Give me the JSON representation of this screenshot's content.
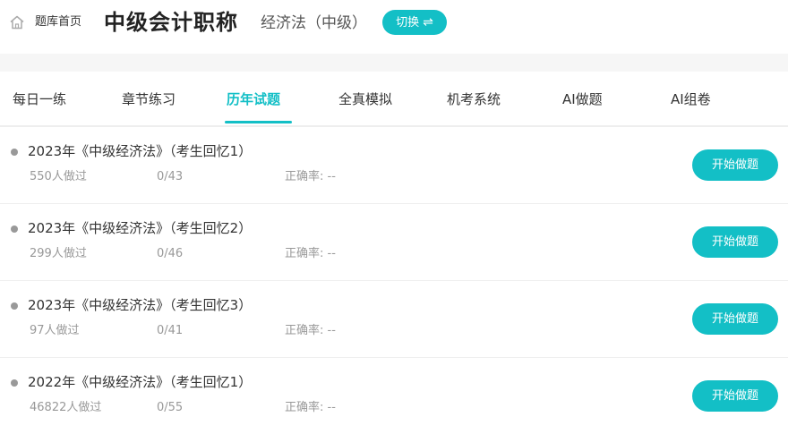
{
  "header": {
    "home_label": "题库首页",
    "title": "中级会计职称",
    "subject": "经济法（中级）",
    "switch_label": "切换",
    "switch_icon": "swap-arrows-icon"
  },
  "tabs": [
    {
      "label": "每日一练",
      "active": false
    },
    {
      "label": "章节练习",
      "active": false
    },
    {
      "label": "历年试题",
      "active": true
    },
    {
      "label": "全真模拟",
      "active": false
    },
    {
      "label": "机考系统",
      "active": false
    },
    {
      "label": "AI做题",
      "active": false
    },
    {
      "label": "AI组卷",
      "active": false
    }
  ],
  "papers": [
    {
      "title": "2023年《中级经济法》（考生回忆1）",
      "done_count": "550人做过",
      "progress": "0/43",
      "accuracy": "正确率: --",
      "button": "开始做题"
    },
    {
      "title": "2023年《中级经济法》（考生回忆2）",
      "done_count": "299人做过",
      "progress": "0/46",
      "accuracy": "正确率: --",
      "button": "开始做题"
    },
    {
      "title": "2023年《中级经济法》（考生回忆3）",
      "done_count": "97人做过",
      "progress": "0/41",
      "accuracy": "正确率: --",
      "button": "开始做题"
    },
    {
      "title": "2022年《中级经济法》（考生回忆1）",
      "done_count": "46822人做过",
      "progress": "0/55",
      "accuracy": "正确率: --",
      "button": "开始做题"
    }
  ],
  "colors": {
    "accent": "#13bfc6",
    "muted": "#999999"
  }
}
